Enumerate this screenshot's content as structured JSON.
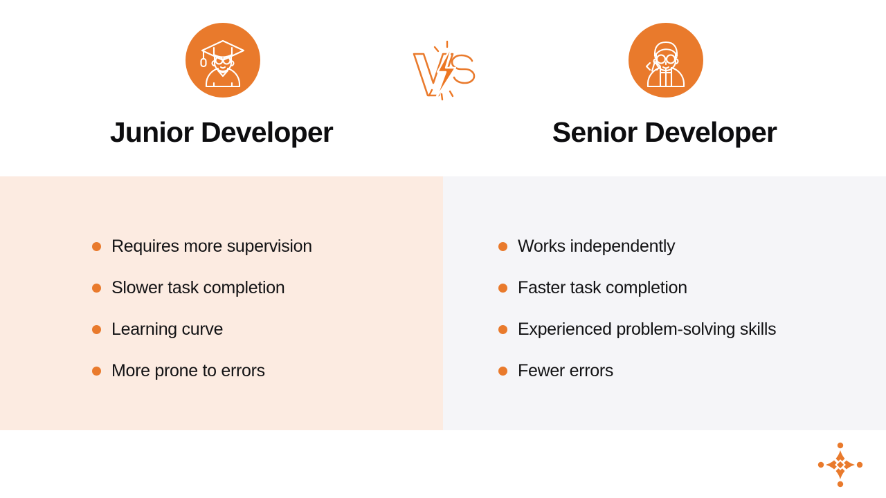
{
  "slide": {
    "background_color": "#FFFFFF",
    "accent_color": "#E97A2C",
    "title_color": "#0D0D0F"
  },
  "header": {
    "left": {
      "title": "Junior Developer",
      "icon": "graduate-student-icon",
      "icon_badge_color": "#E97A2C"
    },
    "right": {
      "title": "Senior Developer",
      "icon": "developer-person-code-icon",
      "icon_badge_color": "#E97A2C"
    },
    "divider": {
      "icon": "versus-lightning-bolt-icon",
      "letters": [
        "V",
        "S"
      ]
    }
  },
  "panels": {
    "left": {
      "background_color": "#FCEBE1",
      "bullets": [
        "Requires more supervision",
        "Slower task completion",
        "Learning curve",
        "More prone to errors"
      ]
    },
    "right": {
      "background_color": "#F5F5F8",
      "bullets": [
        "Works independently",
        "Faster task completion",
        "Experienced problem-solving skills",
        "Fewer errors"
      ]
    }
  },
  "footer": {
    "logo": "four-point-star-logo",
    "logo_color": "#E97A2C"
  }
}
